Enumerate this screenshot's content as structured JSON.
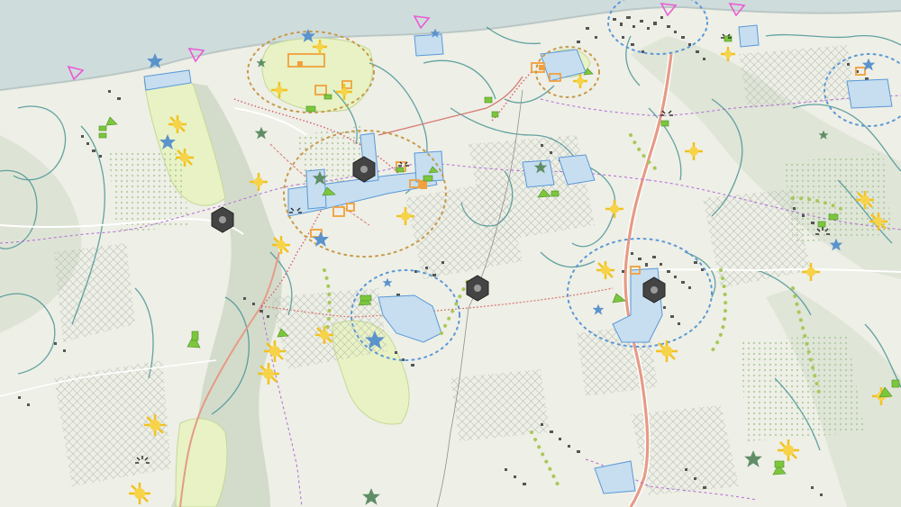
{
  "map": {
    "colors": {
      "sea": "#cfdcdc",
      "land": "#eeefe6",
      "park": "#e7f1c4",
      "valley": "#cfd9c6",
      "contour": "#3f8f92",
      "road_main": "#e59b86",
      "road_minor": "#ffffff",
      "boundary": "#b06ad8",
      "rail": "#d6596f",
      "building": "#4a4a4a",
      "water_blue": "#c6def0",
      "urban_blue": "#5a98d8",
      "orange": "#f0a13c",
      "gold": "#f2c21f",
      "green": "#7cc63e",
      "star_blue": "#5b93cc",
      "star_green": "#5f8e66",
      "marker_dark": "#444444",
      "tri_pink": "#ea5bd4",
      "dot_green": "#a8c85a"
    },
    "layers": [
      {
        "name": "sea"
      },
      {
        "name": "valleys"
      },
      {
        "name": "parks"
      },
      {
        "name": "contours"
      },
      {
        "name": "hatching"
      },
      {
        "name": "roads"
      },
      {
        "name": "boundaries"
      },
      {
        "name": "settlements"
      },
      {
        "name": "facilities"
      },
      {
        "name": "symbols"
      }
    ]
  }
}
